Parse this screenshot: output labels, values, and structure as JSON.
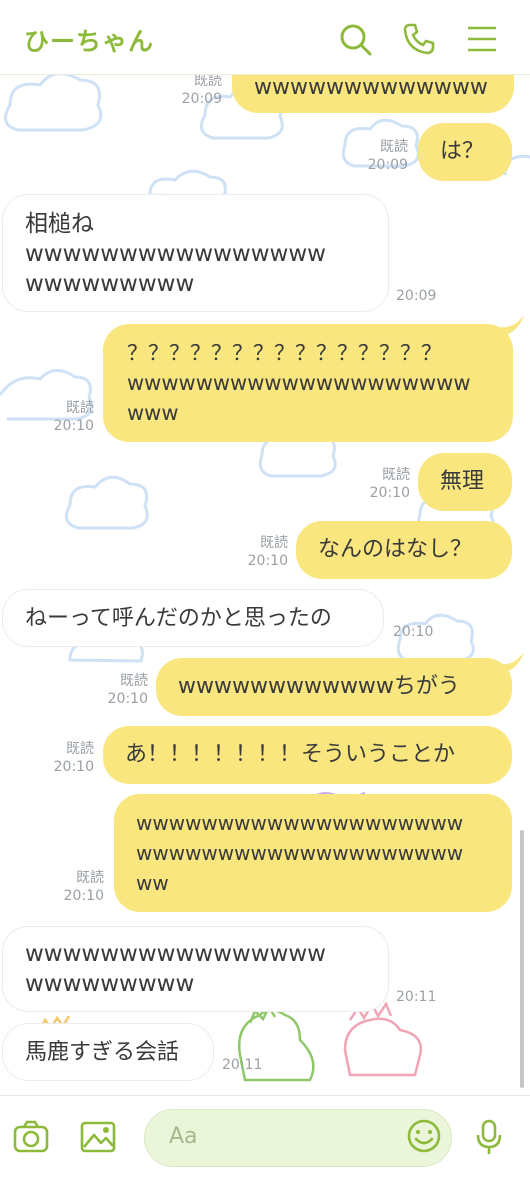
{
  "header": {
    "title": "ひーちゃん",
    "icons": [
      "search-icon",
      "phone-icon",
      "menu-icon"
    ]
  },
  "colors": {
    "accent": "#8dba3a",
    "sent_bubble": "#f9e67f",
    "received_bubble": "#ffffff"
  },
  "messages": [
    {
      "id": "m1",
      "side": "sent",
      "text": "wwwwwwwwwwwww",
      "read": "既読",
      "time": "20:09"
    },
    {
      "id": "m2",
      "side": "sent",
      "text": "は？",
      "read": "既読",
      "time": "20:09"
    },
    {
      "id": "m3",
      "side": "received",
      "text": "相槌ね\nwwwwwwwwwwwwwwww\nwwwwwwwww",
      "time": "20:09"
    },
    {
      "id": "m4",
      "side": "sent",
      "text": "？？？？？？？？？？？？？？？\nwwwwwwwwwwwwwwwwwwww\nwww",
      "read": "既読",
      "time": "20:10"
    },
    {
      "id": "m5",
      "side": "sent",
      "text": "無理",
      "read": "既読",
      "time": "20:10"
    },
    {
      "id": "m6",
      "side": "sent",
      "text": "なんのはなし？",
      "read": "既読",
      "time": "20:10"
    },
    {
      "id": "m7",
      "side": "received",
      "text": "ねーって呼んだのかと思ったの",
      "time": "20:10"
    },
    {
      "id": "m8",
      "side": "sent",
      "text": "wwwwwwwwwwwwちがう",
      "read": "既読",
      "time": "20:10"
    },
    {
      "id": "m9",
      "side": "sent",
      "text": "あ！！！！！！！そういうことか",
      "read": "既読",
      "time": "20:10"
    },
    {
      "id": "m10",
      "side": "sent",
      "text": "wwwwwwwwwwwwwwwwwwww\nwwwwwwwwwwwwwwwwwwww\nww",
      "read": "既読",
      "time": "20:10"
    },
    {
      "id": "m11",
      "side": "received",
      "text": "wwwwwwwwwwwwwwww\nwwwwwwwww",
      "time": "20:11"
    },
    {
      "id": "m12",
      "side": "received",
      "text": "馬鹿すぎる会話",
      "time": "20:11"
    }
  ],
  "input": {
    "placeholder": "Aa"
  },
  "bottom_icons": [
    "camera-icon",
    "image-icon",
    "emoji-icon",
    "microphone-icon"
  ]
}
